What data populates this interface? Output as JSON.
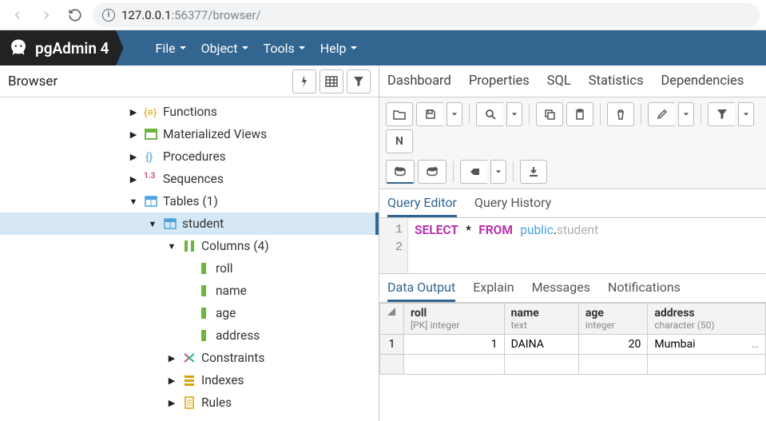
{
  "url": {
    "host": "127.0.0.1",
    "port": ":56377",
    "path": "/browser/"
  },
  "brand": "pgAdmin 4",
  "menu": [
    "File",
    "Object",
    "Tools",
    "Help"
  ],
  "browser_label": "Browser",
  "tree": {
    "functions": "Functions",
    "matviews": "Materialized Views",
    "procedures": "Procedures",
    "sequences": "Sequences",
    "seq_prefix": "1.3",
    "tables": "Tables (1)",
    "student": "student",
    "columns": "Columns (4)",
    "cols": [
      "roll",
      "name",
      "age",
      "address"
    ],
    "constraints": "Constraints",
    "indexes": "Indexes",
    "rules": "Rules"
  },
  "main_tabs": [
    "Dashboard",
    "Properties",
    "SQL",
    "Statistics",
    "Dependencies"
  ],
  "query_tabs": [
    "Query Editor",
    "Query History"
  ],
  "sql": {
    "kw1": "SELECT",
    "star": "*",
    "kw2": "FROM",
    "schema": "public",
    "dot": ".",
    "table": "student"
  },
  "data_tabs": [
    "Data Output",
    "Explain",
    "Messages",
    "Notifications"
  ],
  "columns": [
    {
      "name": "roll",
      "type": "[PK] integer",
      "align": "r"
    },
    {
      "name": "name",
      "type": "text",
      "align": "l"
    },
    {
      "name": "age",
      "type": "integer",
      "align": "r"
    },
    {
      "name": "address",
      "type": "character (50)",
      "align": "l"
    }
  ],
  "rows": [
    {
      "n": "1",
      "roll": "1",
      "name": "DAINA",
      "age": "20",
      "address": "Mumbai"
    }
  ],
  "N_label": "N"
}
